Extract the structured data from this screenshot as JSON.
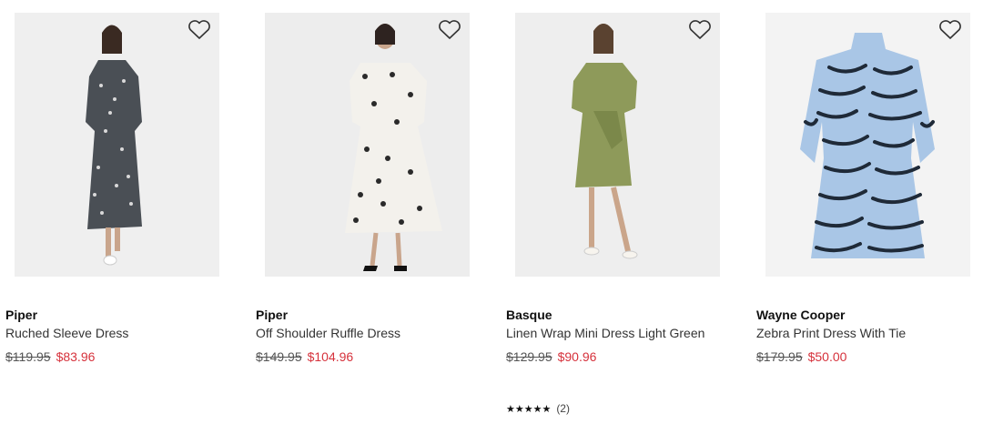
{
  "products": [
    {
      "brand": "Piper",
      "name": "Ruched Sleeve Dress",
      "was_price": "$119.95",
      "sale_price": "$83.96",
      "colors": {
        "bg": "#efefef",
        "dress": "#4a4f55",
        "dot": "#d9d9d9"
      }
    },
    {
      "brand": "Piper",
      "name": "Off Shoulder Ruffle Dress",
      "was_price": "$149.95",
      "sale_price": "$104.96",
      "colors": {
        "bg": "#ededed",
        "dress": "#f3f1ec",
        "dot": "#2a2a2a"
      }
    },
    {
      "brand": "Basque",
      "name": "Linen Wrap Mini Dress Light Green",
      "was_price": "$129.95",
      "sale_price": "$90.96",
      "rating_stars": "★★★★★",
      "rating_count": "(2)",
      "colors": {
        "bg": "#eeeeee",
        "dress": "#8e9a5a",
        "dot": "#7b884a"
      }
    },
    {
      "brand": "Wayne Cooper",
      "name": "Zebra Print Dress With Tie",
      "was_price": "$179.95",
      "sale_price": "$50.00",
      "colors": {
        "bg": "#f3f3f3",
        "dress": "#a9c6e6",
        "dot": "#1f2a38"
      }
    }
  ],
  "icons": {
    "wishlist": "heart-outline-icon"
  }
}
